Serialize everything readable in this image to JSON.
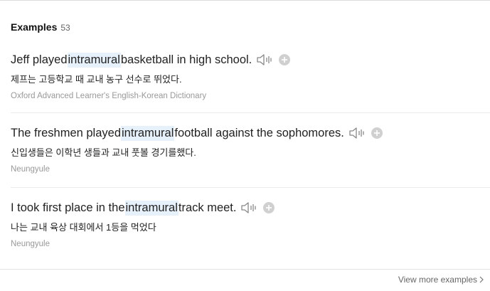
{
  "section": {
    "title": "Examples",
    "count": "53"
  },
  "examples": [
    {
      "before": "Jeff played ",
      "highlight": "intramural",
      "after": " basketball in high school.",
      "translation": "제프는 고등학교 때 교내 농구 선수로 뛰었다.",
      "source": "Oxford Advanced Learner's English-Korean Dictionary",
      "speaker_icon": "speaker-icon",
      "add_icon": "plus-circle-icon"
    },
    {
      "before": "The freshmen played ",
      "highlight": "intramural",
      "after": " football against the sophomores.",
      "translation": "신입생들은 이학년 생들과 교내 풋볼 경기를했다.",
      "source": "Neungyule",
      "speaker_icon": "speaker-icon",
      "add_icon": "plus-circle-icon"
    },
    {
      "before": "I took first place in the ",
      "highlight": "intramural",
      "after": " track meet.",
      "translation": "나는 교내 육상 대회에서 1등을 먹었다",
      "source": "Neungyule",
      "speaker_icon": "speaker-icon",
      "add_icon": "plus-circle-icon"
    }
  ],
  "footer": {
    "more_label": "View more examples",
    "more_icon": "chevron-right-icon"
  },
  "colors": {
    "highlight_bg": "#e6f1fb",
    "source_text": "#999999",
    "icon_gray": "#888888",
    "plus_gray": "#d0d0d0"
  }
}
